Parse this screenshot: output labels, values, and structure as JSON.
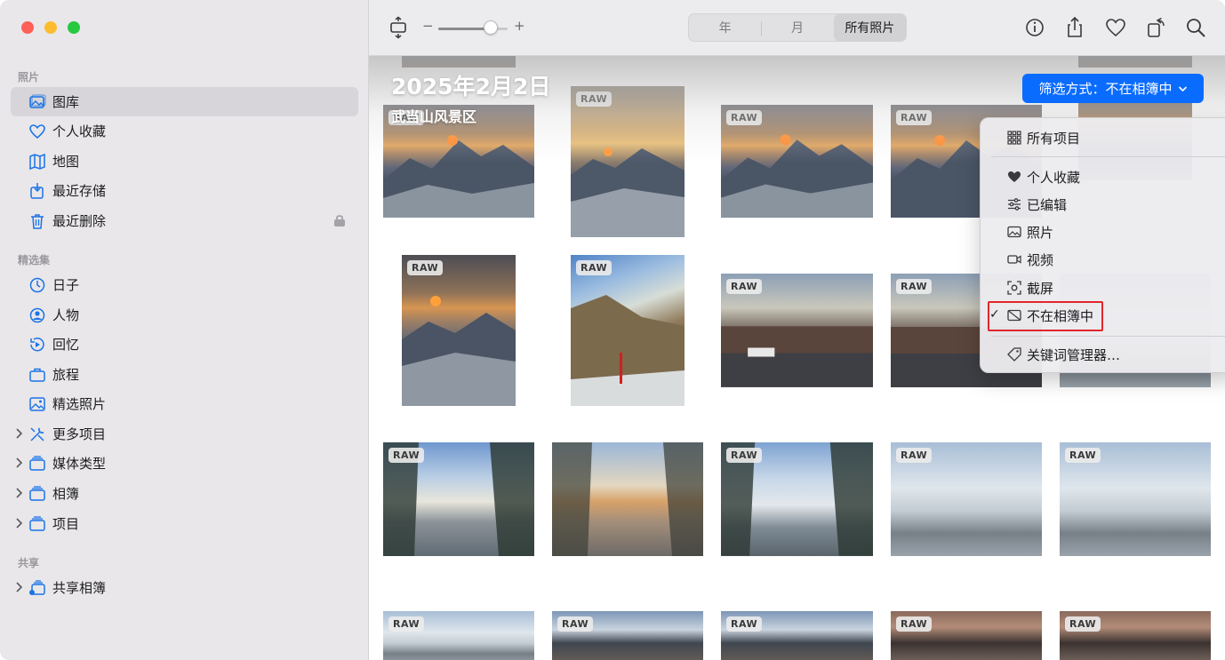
{
  "sidebar": {
    "sections": {
      "photos": "照片",
      "collections": "精选集",
      "shared": "共享"
    },
    "items": [
      {
        "label": "图库"
      },
      {
        "label": "个人收藏"
      },
      {
        "label": "地图"
      },
      {
        "label": "最近存储"
      },
      {
        "label": "最近删除"
      },
      {
        "label": "日子"
      },
      {
        "label": "人物"
      },
      {
        "label": "回忆"
      },
      {
        "label": "旅程"
      },
      {
        "label": "精选照片"
      },
      {
        "label": "更多项目"
      },
      {
        "label": "媒体类型"
      },
      {
        "label": "相簿"
      },
      {
        "label": "项目"
      },
      {
        "label": "共享相簿"
      }
    ]
  },
  "toolbar": {
    "zoom_minus": "−",
    "zoom_plus": "+",
    "zoom_value": 0.75,
    "segments": [
      "年",
      "月",
      "所有照片"
    ],
    "active_segment": "所有照片"
  },
  "gallery": {
    "date_title": "2025年2月2日",
    "location": "武当山风景区",
    "raw_badge": "RAW"
  },
  "filter": {
    "button_label": "筛选方式：不在相簿中",
    "menu": [
      {
        "label": "所有项目"
      },
      {
        "label": "个人收藏"
      },
      {
        "label": "已编辑"
      },
      {
        "label": "照片"
      },
      {
        "label": "视频"
      },
      {
        "label": "截屏"
      },
      {
        "label": "不在相簿中"
      },
      {
        "label": "关键词管理器…"
      }
    ],
    "checked": "不在相簿中"
  },
  "colors": {
    "accent": "#0a6cff",
    "sidebar_bg": "#e9e7ea",
    "highlight": "#e0262b"
  }
}
